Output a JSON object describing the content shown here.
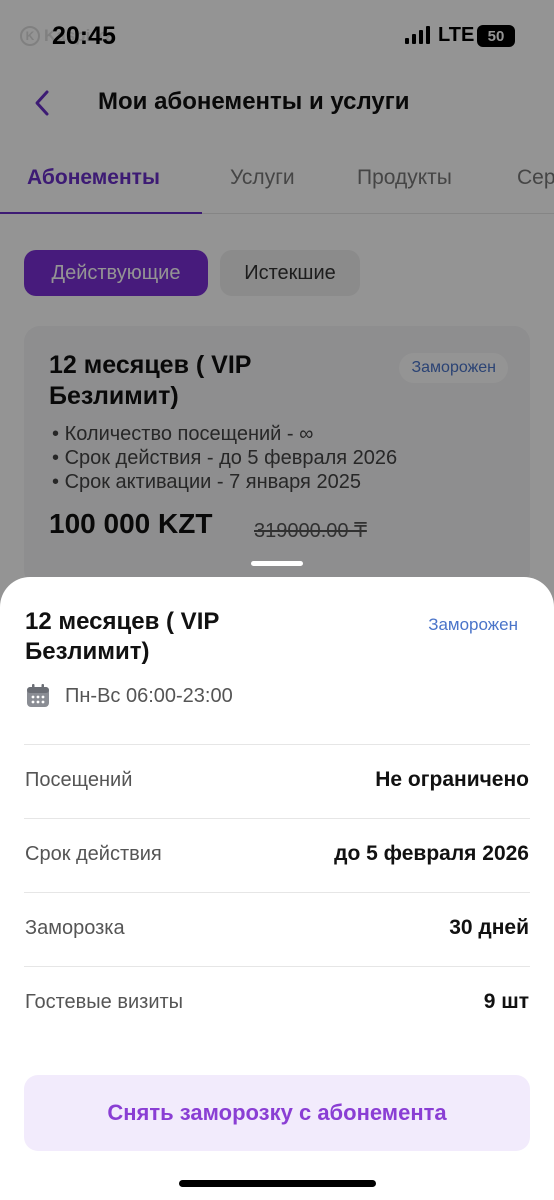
{
  "status_bar": {
    "time": "20:45",
    "network": "LTE",
    "battery": "50",
    "watermark": "Kaspi.kz"
  },
  "header": {
    "title": "Мои абонементы и услуги",
    "back_icon": "chevron-left-icon"
  },
  "tabs": [
    {
      "label": "Абонементы",
      "active": true
    },
    {
      "label": "Услуги",
      "active": false
    },
    {
      "label": "Продукты",
      "active": false
    },
    {
      "label": "Сер",
      "active": false
    }
  ],
  "filters": {
    "active": "Действующие",
    "inactive": "Истекшие"
  },
  "card": {
    "title": "12 месяцев ( VIP Безлимит)",
    "badge": "Заморожен",
    "details": [
      "Количество посещений - ∞",
      "Срок действия - до 5 февраля 2026",
      "Срок активации - 7 января 2025"
    ],
    "price": "100 000 KZT",
    "old_price": "319000.00 ₸"
  },
  "sheet": {
    "title": "12 месяцев ( VIP Безлимит)",
    "badge": "Заморожен",
    "schedule": "Пн-Вс 06:00-23:00",
    "schedule_icon": "calendar-icon",
    "rows": [
      {
        "label": "Посещений",
        "value": "Не ограничено"
      },
      {
        "label": "Срок действия",
        "value": "до 5 февраля 2026"
      },
      {
        "label": "Заморозка",
        "value": "30 дней"
      },
      {
        "label": "Гостевые визиты",
        "value": "9 шт"
      }
    ],
    "action_label": "Снять заморозку с абонемента"
  },
  "colors": {
    "accent": "#7b2fd6",
    "badge_text": "#4a74c9",
    "button_bg": "#f2ebfc"
  }
}
